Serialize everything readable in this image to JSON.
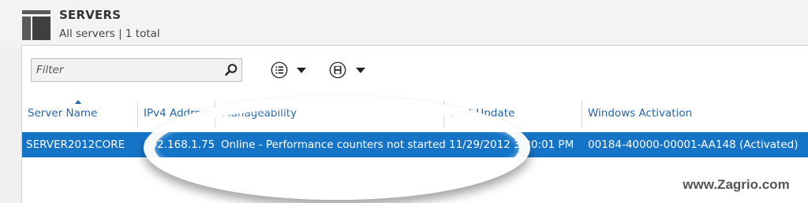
{
  "header": {
    "title": "SERVERS",
    "subtitle": "All servers | 1 total",
    "icon": "server-stack-icon"
  },
  "toolbar": {
    "filter_placeholder": "Filter",
    "search_icon": "search-icon",
    "list_view_icon": "list-options-icon",
    "save_icon": "save-icon",
    "dropdown_icon": "chevron-down-icon"
  },
  "table": {
    "columns": [
      "Server Name",
      "IPv4 Address",
      "Manageability",
      "Last Update",
      "Windows Activation"
    ],
    "sorted_column": "Server Name",
    "rows": [
      {
        "server_name": "SERVER2012CORE",
        "ipv4": "192.168.1.75",
        "manageability": "Online - Performance counters not started",
        "last_update": "11/29/2012 3:20:01 PM",
        "activation": "00184-40000-00001-AA148 (Activated)",
        "selected": true
      }
    ]
  },
  "watermark": "www.Zagrio.com",
  "colors": {
    "accent": "#2566a9",
    "selection": "#1674c7"
  }
}
